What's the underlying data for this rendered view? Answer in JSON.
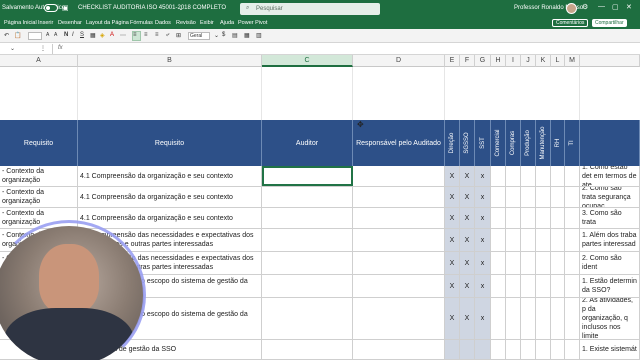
{
  "titlebar": {
    "autosave_label": "Salvamento Automático",
    "doc_title": "CHECKLIST AUDITORIA ISO 45001-2018 COMPLETO",
    "search_placeholder": "Pesquisar",
    "user_name": "Professor Ronaldo Messo"
  },
  "menu": {
    "items": [
      "Página Inicial",
      "Inserir",
      "Desenhar",
      "Layout da Página",
      "Fórmulas",
      "Dados",
      "Revisão",
      "Exibir",
      "Ajuda",
      "Power Pivot"
    ],
    "comments_label": "Comentários",
    "share_label": "Compartilhar"
  },
  "ribbon": {
    "number_format": "Geral"
  },
  "formula_bar": {
    "name_box": "",
    "fx": "fx"
  },
  "columns": [
    "A",
    "B",
    "C",
    "D",
    "E",
    "F",
    "G",
    "H",
    "I",
    "J",
    "K",
    "L",
    "M"
  ],
  "table_header": {
    "requisito_a": "Requisito",
    "requisito_b": "Requisito",
    "auditor": "Auditor",
    "responsavel": "Responsável pelo Auditado",
    "direcao": "Direção",
    "sgsso": "SGSSO",
    "sst": "SST",
    "comercial": "Comercial",
    "compras": "Compras",
    "producao": "Produção",
    "manutencao": "Manutenção",
    "rh": "RH",
    "ti": "TI"
  },
  "rows": [
    {
      "a": "- Contexto da organização",
      "b": "4.1 Compreensão da organização e seu contexto",
      "e": "X",
      "f": "X",
      "g": "x",
      "n": "1. Como estão det em termos de ate"
    },
    {
      "a": "- Contexto da organização",
      "b": "4.1 Compreensão da organização e seu contexto",
      "e": "X",
      "f": "X",
      "g": "x",
      "n": "2. Como são trata segurança ocupac"
    },
    {
      "a": "- Contexto da organização",
      "b": "4.1 Compreensão da organização e seu contexto",
      "e": "X",
      "f": "X",
      "g": "x",
      "n": "3. Como são trata"
    },
    {
      "a": "- Contexto da organização",
      "b": "4.2 Compreensão das necessidades e expectativas dos trabalhadores e outras partes interessadas",
      "e": "X",
      "f": "X",
      "g": "x",
      "n": "1. Além dos traba partes interessad"
    },
    {
      "a": "- Contexto da organização",
      "b": "4.2 Compreensão das necessidades e expectativas dos trabalhadores e outras partes interessadas",
      "e": "X",
      "f": "X",
      "g": "x",
      "n": "2. Como são ident"
    },
    {
      "a": "- Contexto da organização",
      "b": "4.3 Determinação do escopo do sistema de gestão da SSO",
      "e": "X",
      "f": "X",
      "g": "x",
      "n": "1. Estão determin da SSO?"
    },
    {
      "a": "- Contexto da organização",
      "b": "4.3 Determinação do escopo do sistema de gestão da SSO",
      "e": "X",
      "f": "X",
      "g": "x",
      "n": "2. As atividades, p da organização, q inclusos nos limite"
    },
    {
      "a": "",
      "b": "4.4 Sistema de gestão da SSO",
      "e": "",
      "f": "",
      "g": "",
      "n": "1. Existe sistemát"
    }
  ]
}
